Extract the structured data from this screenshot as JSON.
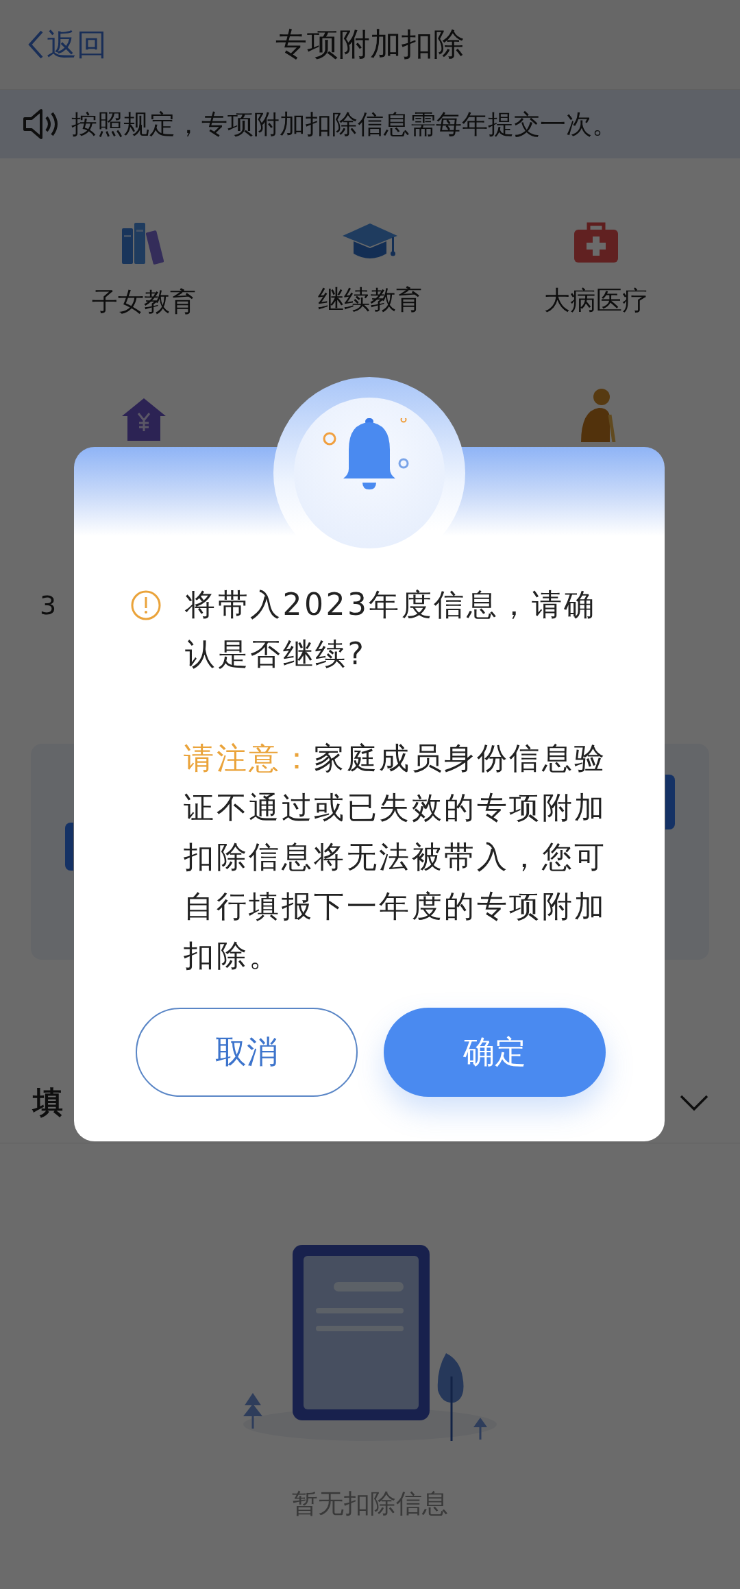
{
  "header": {
    "back_label": "返回",
    "title": "专项附加扣除"
  },
  "notice": {
    "text": "按照规定，专项附加扣除信息需每年提交一次。"
  },
  "categories": [
    {
      "kind": "books",
      "label": "子女教育"
    },
    {
      "kind": "cap",
      "label": "继续教育"
    },
    {
      "kind": "medkit",
      "label": "大病医疗"
    },
    {
      "kind": "house"
    },
    {
      "kind": "none"
    },
    {
      "kind": "elder"
    }
  ],
  "row_text": "3",
  "section": {
    "title": "填"
  },
  "empty_state": {
    "text": "暂无扣除信息"
  },
  "dialog": {
    "message": "将带入2023年度信息，请确认是否继续?",
    "note_label": "请注意：",
    "note_text": "家庭成员身份信息验证不通过或已失效的专项附加扣除信息将无法被带入，您可自行填报下一年度的专项附加扣除。",
    "buttons": [
      {
        "kind": "secondary",
        "label": "取消"
      },
      {
        "kind": "primary",
        "label": "确定"
      }
    ]
  }
}
